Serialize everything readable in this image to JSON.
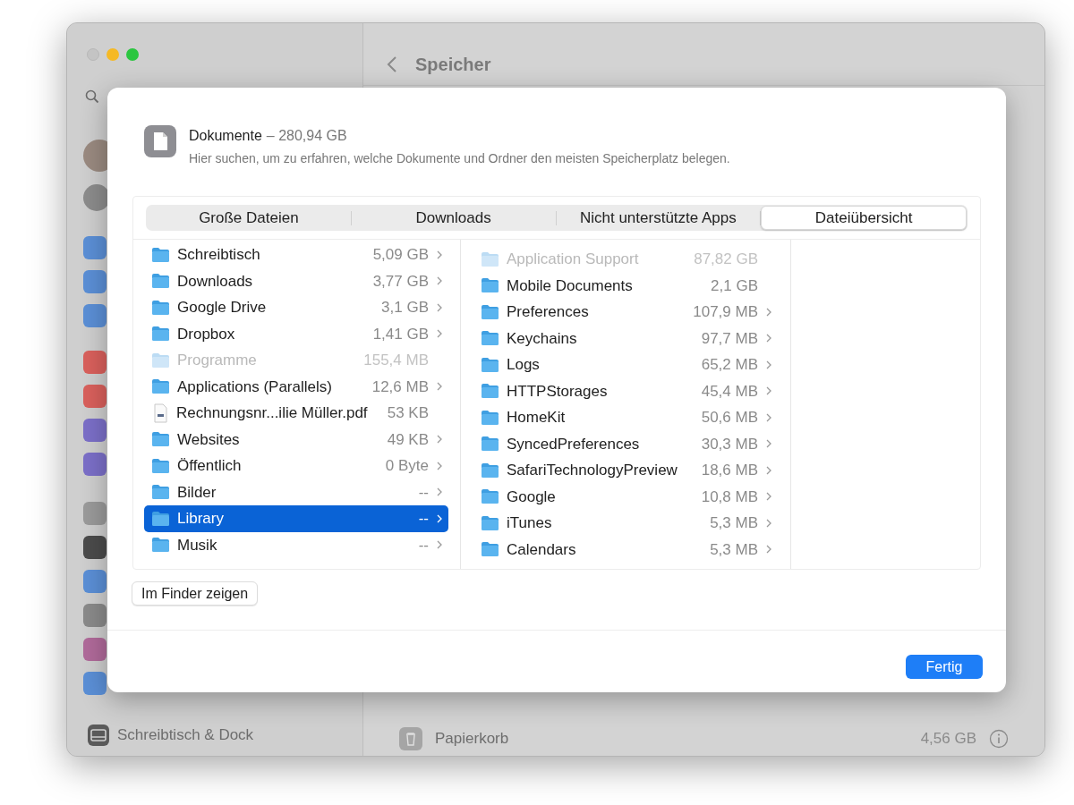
{
  "background_window": {
    "title": "Speicher",
    "sidebar_items": [
      {
        "label": "Schreibtisch & Dock"
      }
    ],
    "storage_rows": [
      {
        "label": "Papierkorb",
        "size": "4,56 GB"
      }
    ]
  },
  "sheet": {
    "title": "Dokumente",
    "size_text": "– 280,94 GB",
    "subtitle": "Hier suchen, um zu erfahren, welche Dokumente und Ordner den meisten Speicherplatz belegen.",
    "tabs": [
      {
        "label": "Große Dateien",
        "selected": false
      },
      {
        "label": "Downloads",
        "selected": false
      },
      {
        "label": "Nicht unterstützte Apps",
        "selected": false
      },
      {
        "label": "Dateiübersicht",
        "selected": true
      }
    ],
    "columns": [
      {
        "rows": [
          {
            "kind": "folder",
            "name": "Schreibtisch",
            "size": "5,09 GB",
            "chevron": true,
            "disabled": false,
            "selected": false
          },
          {
            "kind": "folder",
            "name": "Downloads",
            "size": "3,77 GB",
            "chevron": true,
            "disabled": false,
            "selected": false
          },
          {
            "kind": "folder",
            "name": "Google Drive",
            "size": "3,1 GB",
            "chevron": true,
            "disabled": false,
            "selected": false
          },
          {
            "kind": "folder",
            "name": "Dropbox",
            "size": "1,41 GB",
            "chevron": true,
            "disabled": false,
            "selected": false
          },
          {
            "kind": "folder",
            "name": "Programme",
            "size": "155,4 MB",
            "chevron": false,
            "disabled": true,
            "selected": false
          },
          {
            "kind": "folder",
            "name": "Applications (Parallels)",
            "size": "12,6 MB",
            "chevron": true,
            "disabled": false,
            "selected": false
          },
          {
            "kind": "file",
            "name": "Rechnungsnr...ilie Müller.pdf",
            "size": "53 KB",
            "chevron": false,
            "disabled": false,
            "selected": false
          },
          {
            "kind": "folder",
            "name": "Websites",
            "size": "49 KB",
            "chevron": true,
            "disabled": false,
            "selected": false
          },
          {
            "kind": "folder",
            "name": "Öffentlich",
            "size": "0 Byte",
            "chevron": true,
            "disabled": false,
            "selected": false
          },
          {
            "kind": "folder",
            "name": "Bilder",
            "size": "--",
            "chevron": true,
            "disabled": false,
            "selected": false
          },
          {
            "kind": "folder",
            "name": "Library",
            "size": "--",
            "chevron": true,
            "disabled": false,
            "selected": true
          },
          {
            "kind": "folder",
            "name": "Musik",
            "size": "--",
            "chevron": true,
            "disabled": false,
            "selected": false
          }
        ]
      },
      {
        "rows": [
          {
            "kind": "folder",
            "name": "Application Support",
            "size": "87,82 GB",
            "chevron": false,
            "disabled": true,
            "selected": false
          },
          {
            "kind": "folder",
            "name": "Mobile Documents",
            "size": "2,1 GB",
            "chevron": false,
            "disabled": false,
            "selected": false
          },
          {
            "kind": "folder",
            "name": "Preferences",
            "size": "107,9 MB",
            "chevron": true,
            "disabled": false,
            "selected": false
          },
          {
            "kind": "folder",
            "name": "Keychains",
            "size": "97,7 MB",
            "chevron": true,
            "disabled": false,
            "selected": false
          },
          {
            "kind": "folder",
            "name": "Logs",
            "size": "65,2 MB",
            "chevron": true,
            "disabled": false,
            "selected": false
          },
          {
            "kind": "folder",
            "name": "HTTPStorages",
            "size": "45,4 MB",
            "chevron": true,
            "disabled": false,
            "selected": false
          },
          {
            "kind": "folder",
            "name": "HomeKit",
            "size": "50,6 MB",
            "chevron": true,
            "disabled": false,
            "selected": false
          },
          {
            "kind": "folder",
            "name": "SyncedPreferences",
            "size": "30,3 MB",
            "chevron": true,
            "disabled": false,
            "selected": false
          },
          {
            "kind": "folder",
            "name": "SafariTechnologyPreview",
            "size": "18,6 MB",
            "chevron": true,
            "disabled": false,
            "selected": false
          },
          {
            "kind": "folder",
            "name": "Google",
            "size": "10,8 MB",
            "chevron": true,
            "disabled": false,
            "selected": false
          },
          {
            "kind": "folder",
            "name": "iTunes",
            "size": "5,3 MB",
            "chevron": true,
            "disabled": false,
            "selected": false
          },
          {
            "kind": "folder",
            "name": "Calendars",
            "size": "5,3 MB",
            "chevron": true,
            "disabled": false,
            "selected": false
          }
        ]
      }
    ],
    "show_in_finder_button": "Im Finder zeigen",
    "done_button": "Fertig"
  }
}
